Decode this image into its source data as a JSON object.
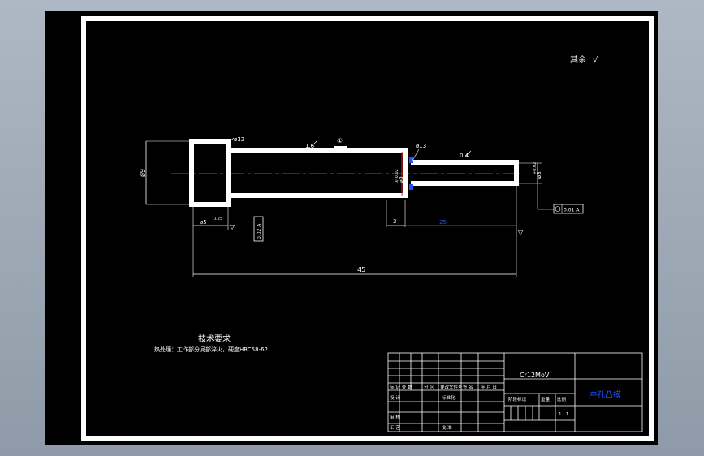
{
  "surface_note": "其余",
  "dims": {
    "head_dia": "ø9",
    "head_chamfer": "ø12",
    "body_mark": "1.6",
    "gauge_mark": "①",
    "groove_mark": "ø13",
    "body_dia": "ø6",
    "body_tol": "0/-0.02",
    "tip_mark": "0.4",
    "tip_dia": "ø3",
    "tip_tol": "+0.02",
    "fcf_left": "0.02 A",
    "fcf_right": "0.01 A",
    "head_pos": "ø5",
    "head_pos_tol": "0.25",
    "gap": "3",
    "tip_length": "25",
    "total_length": "45"
  },
  "tech": {
    "title": "技术要求",
    "line": "热处理：工作部分局部淬火，硬度HRC58-62"
  },
  "title_block": {
    "material": "Cr12MoV",
    "part_name": "冲孔凸模",
    "row_labels": [
      "标 记",
      "处 数",
      "分 区",
      "更改文件号",
      "签 名",
      "年 月 日"
    ],
    "design": "设 计",
    "standardize": "标准化",
    "check": "审 核",
    "process": "工 艺",
    "approve": "批 准",
    "stage_header": "阶段标记",
    "weight_header": "重量",
    "scale_header": "比例",
    "sheet": "1 : 1"
  }
}
